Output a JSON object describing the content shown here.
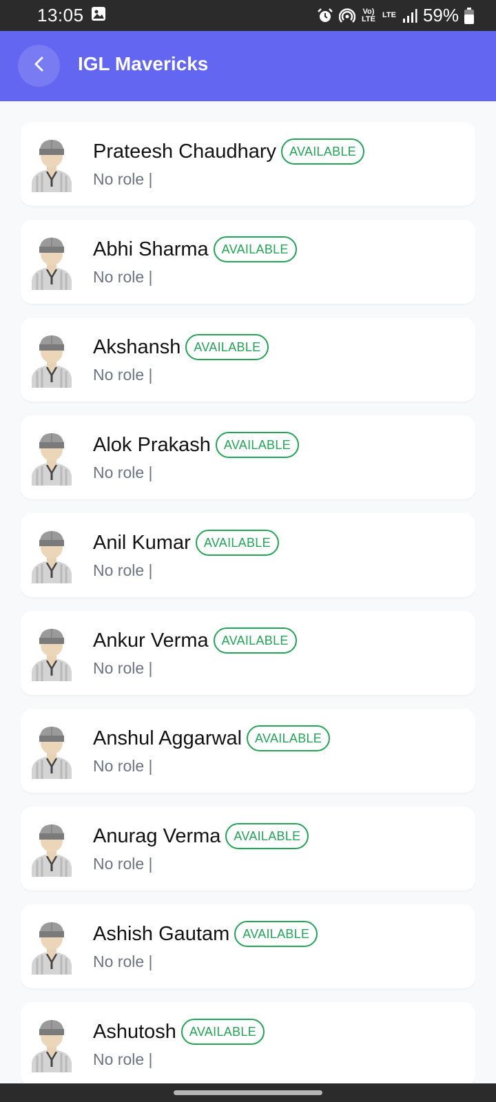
{
  "status_bar": {
    "time": "13:05",
    "battery": "59%",
    "icons": [
      "image-icon",
      "alarm-icon",
      "hotspot-icon",
      "volte-icon",
      "lte-icon",
      "signal-icon",
      "battery-icon"
    ],
    "volte_label": "Vo) LTE",
    "lte_label": "LTE"
  },
  "app_bar": {
    "title": "IGL Mavericks",
    "back_icon": "chevron-left-icon",
    "background": "#6366f1"
  },
  "players": [
    {
      "name": "Prateesh Chaudhary",
      "status": "AVAILABLE",
      "role": "No role |"
    },
    {
      "name": "Abhi Sharma",
      "status": "AVAILABLE",
      "role": "No role |"
    },
    {
      "name": "Akshansh",
      "status": "AVAILABLE",
      "role": "No role |"
    },
    {
      "name": "Alok Prakash",
      "status": "AVAILABLE",
      "role": "No role |"
    },
    {
      "name": "Anil Kumar",
      "status": "AVAILABLE",
      "role": "No role |"
    },
    {
      "name": "Ankur Verma",
      "status": "AVAILABLE",
      "role": "No role |"
    },
    {
      "name": "Anshul Aggarwal",
      "status": "AVAILABLE",
      "role": "No role |"
    },
    {
      "name": "Anurag Verma",
      "status": "AVAILABLE",
      "role": "No role |"
    },
    {
      "name": "Ashish Gautam",
      "status": "AVAILABLE",
      "role": "No role |"
    },
    {
      "name": "Ashutosh",
      "status": "AVAILABLE",
      "role": "No role |"
    }
  ],
  "colors": {
    "accent": "#6366f1",
    "available_green": "#22a356",
    "role_gray": "#6b7280"
  }
}
